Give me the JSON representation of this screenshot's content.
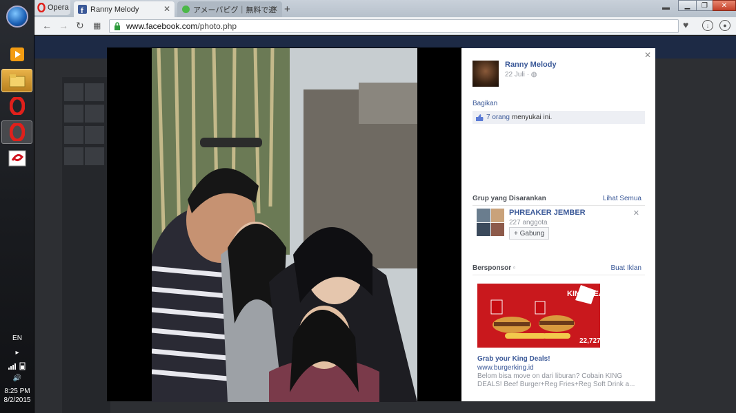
{
  "taskbar": {
    "lang": "EN",
    "time": "8:25 PM",
    "date": "8/2/2015"
  },
  "browser": {
    "opera_label": "Opera",
    "tabs": [
      {
        "label": "Ranny Melody"
      },
      {
        "label": "アメーバピグ｜無料で遊"
      }
    ],
    "url_host": "www.facebook.com",
    "url_path": "/photo.php"
  },
  "panel": {
    "poster_name": "Ranny Melody",
    "post_date": "22 Juli",
    "share_label": "Bagikan",
    "likes_count": "7 orang",
    "likes_suffix": "menyukai ini.",
    "suggested_title": "Grup yang Disarankan",
    "see_all": "Lihat Semua",
    "group": {
      "name": "PHREAKER JEMBER",
      "members": "227 anggota",
      "join_label": "+ Gabung"
    },
    "sponsored_title": "Bersponsor",
    "create_ad": "Buat Iklan",
    "ad": {
      "title": "Grab your King Deals!",
      "url": "www.burgerking.id",
      "desc": "Belom bisa move on dari liburan? Cobain KING DEALS! Beef Burger+Reg Fries+Reg Soft Drink a...",
      "image_banner": "KING DEALS",
      "image_price": "22,727"
    }
  },
  "colors": {
    "fb_blue": "#3b5998",
    "fb_gray": "#90949c",
    "bk_red": "#c9181d"
  }
}
